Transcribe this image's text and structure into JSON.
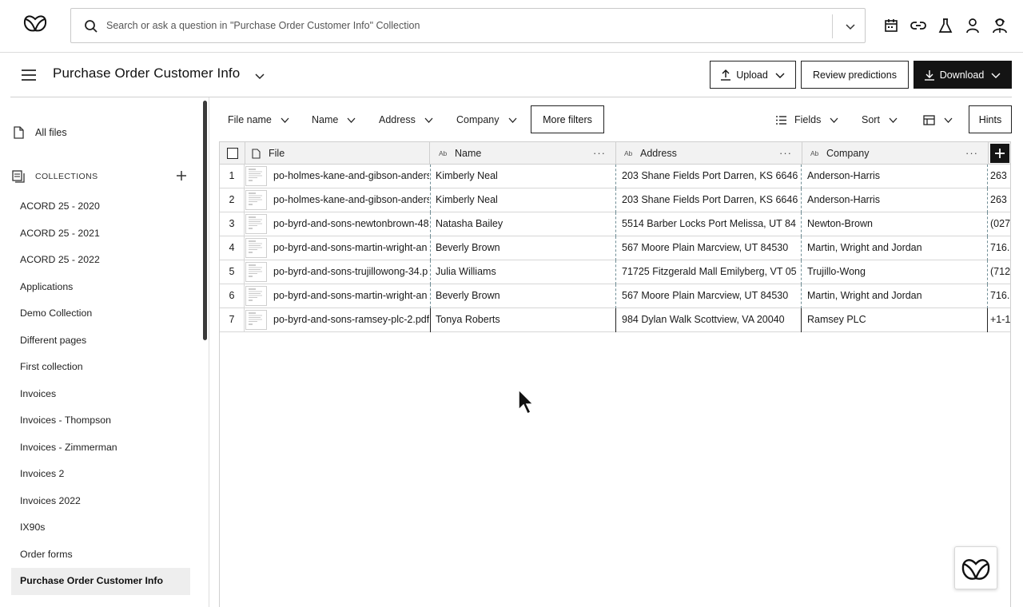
{
  "search": {
    "placeholder": "Search or ask a question in \"Purchase Order Customer Info\" Collection"
  },
  "top_icons": [
    "calendar-icon",
    "link-icon",
    "flask-icon",
    "user-icon",
    "agent-icon"
  ],
  "header": {
    "title": "Purchase Order Customer Info",
    "upload_label": "Upload",
    "review_label": "Review predictions",
    "download_label": "Download"
  },
  "sidebar": {
    "all_files_label": "All files",
    "collections_label": "COLLECTIONS",
    "collections": [
      "ACORD 25 - 2020",
      "ACORD 25 - 2021",
      "ACORD 25 - 2022",
      "Applications",
      "Demo Collection",
      "Different pages",
      "First collection",
      "Invoices",
      "Invoices - Thompson",
      "Invoices - Zimmerman",
      "Invoices 2",
      "Invoices 2022",
      "IX90s",
      "Order forms",
      "Purchase Order Customer Info"
    ],
    "active_collection": "Purchase Order Customer Info"
  },
  "filters": {
    "file_name": "File name",
    "name": "Name",
    "address": "Address",
    "company": "Company",
    "more_filters": "More filters",
    "fields": "Fields",
    "sort": "Sort",
    "hints": "Hints"
  },
  "table": {
    "columns": {
      "file": "File",
      "name": "Name",
      "address": "Address",
      "company": "Company",
      "type_badge": "Ab"
    },
    "rows": [
      {
        "num": "1",
        "file": "po-holmes-kane-and-gibson-anders",
        "name": "Kimberly Neal",
        "address": "203 Shane Fields Port Darren, KS 6646",
        "company": "Anderson-Harris",
        "extra": "263"
      },
      {
        "num": "2",
        "file": "po-holmes-kane-and-gibson-anders",
        "name": "Kimberly Neal",
        "address": "203 Shane Fields Port Darren, KS 6646",
        "company": "Anderson-Harris",
        "extra": "263"
      },
      {
        "num": "3",
        "file": "po-byrd-and-sons-newtonbrown-48",
        "name": "Natasha Bailey",
        "address": "5514 Barber Locks Port Melissa, UT 84",
        "company": "Newton-Brown",
        "extra": "(027"
      },
      {
        "num": "4",
        "file": "po-byrd-and-sons-martin-wright-an",
        "name": "Beverly Brown",
        "address": "567 Moore Plain Marcview, UT 84530",
        "company": "Martin, Wright and Jordan",
        "extra": "716."
      },
      {
        "num": "5",
        "file": "po-byrd-and-sons-trujillowong-34.p",
        "name": "Julia Williams",
        "address": "71725 Fitzgerald Mall Emilyberg, VT 05",
        "company": "Trujillo-Wong",
        "extra": "(712"
      },
      {
        "num": "6",
        "file": "po-byrd-and-sons-martin-wright-an",
        "name": "Beverly Brown",
        "address": "567 Moore Plain Marcview, UT 84530",
        "company": "Martin, Wright and Jordan",
        "extra": "716."
      },
      {
        "num": "7",
        "file": "po-byrd-and-sons-ramsey-plc-2.pdf",
        "name": "Tonya Roberts",
        "address": "984 Dylan Walk Scottview, VA 20040",
        "company": "Ramsey PLC",
        "extra": "+1-1"
      }
    ]
  }
}
